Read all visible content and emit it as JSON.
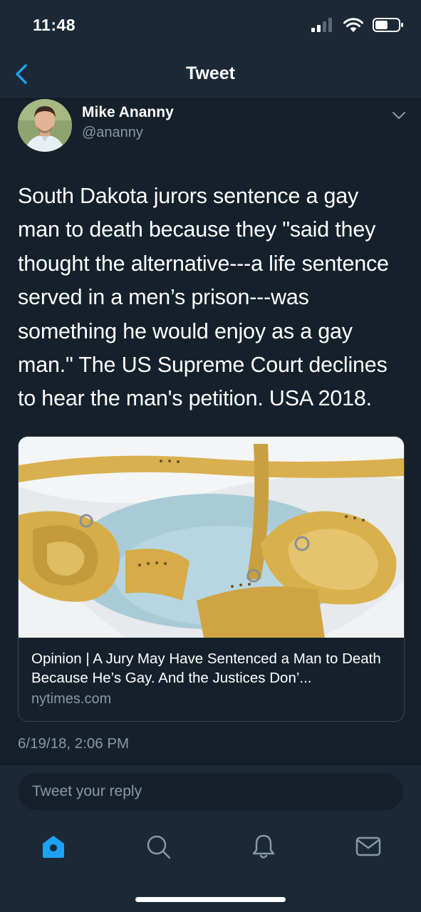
{
  "status_bar": {
    "time": "11:48"
  },
  "nav": {
    "title": "Tweet",
    "back_icon": "chevron-left-icon"
  },
  "tweet": {
    "author_name": "Mike Ananny",
    "author_handle": "@ananny",
    "text": "South Dakota jurors sentence a gay\nman to death because they \"said they\nthought the alternative---a life sentence\nserved in a men’s prison---was\nsomething he would enjoy as a gay\nman.\" The US Supreme Court declines\nto hear the man's petition.  USA 2018.",
    "timestamp": "6/19/18, 2:06 PM"
  },
  "card": {
    "title": "Opinion | A Jury May Have Sentenced a Man to Death Because He’s Gay. And the Justices Don’...",
    "domain": "nytimes.com"
  },
  "reply": {
    "placeholder": "Tweet your reply"
  },
  "tabs": [
    {
      "name": "home",
      "icon": "home-icon",
      "active": true
    },
    {
      "name": "search",
      "icon": "search-icon",
      "active": false
    },
    {
      "name": "notifications",
      "icon": "bell-icon",
      "active": false
    },
    {
      "name": "messages",
      "icon": "mail-icon",
      "active": false
    }
  ],
  "colors": {
    "background": "#15202b",
    "bar_background": "#1b2836",
    "accent": "#1da1f2",
    "secondary_text": "#8899a6",
    "border": "#38444d"
  }
}
